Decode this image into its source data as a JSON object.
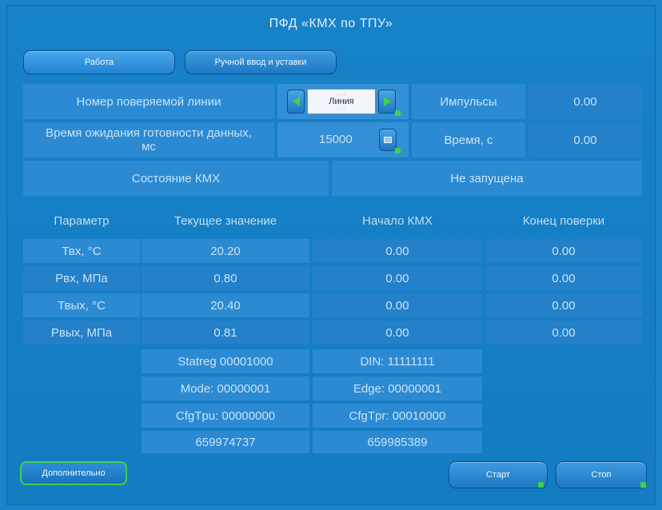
{
  "title": "ПФД «КМХ по ТПУ»",
  "tabs": {
    "work": "Работа",
    "manual": "Ручной ввод и уставки"
  },
  "line_row": {
    "label": "Номер поверяемой линии",
    "line_value": "Линия",
    "impulses_label": "Импульсы",
    "impulses_value": "0.00"
  },
  "wait_row": {
    "label": "Время ожидания готовности данных, мс",
    "value": "15000",
    "time_label": "Время, с",
    "time_value": "0.00"
  },
  "state_row": {
    "label": "Состояние КМХ",
    "value": "Не запущена"
  },
  "table": {
    "headers": [
      "Параметр",
      "Текущее значение",
      "Начало КМХ",
      "Конец поверки"
    ],
    "rows": [
      [
        "Твх, °С",
        "20.20",
        "0.00",
        "0.00"
      ],
      [
        "Рвх, МПа",
        "0.80",
        "0.00",
        "0.00"
      ],
      [
        "Твых, °С",
        "20.40",
        "0.00",
        "0.00"
      ],
      [
        "Рвых, МПа",
        "0.81",
        "0.00",
        "0.00"
      ]
    ]
  },
  "status": {
    "statreg": "Statreg 00001000",
    "din": "DIN:   11111111",
    "mode": "Mode:   00000001",
    "edge": "Edge:   00000001",
    "cfgtpu": "CfgTpu:   00000000",
    "cfgtpr": "CfgTpr:  00010000",
    "counter1": "659974737",
    "counter2": "659985389"
  },
  "buttons": {
    "extra": "Дополнительно",
    "start": "Старт",
    "stop": "Стоп"
  },
  "colors": {
    "background": "#1682c8",
    "accent_green": "#3fd24a"
  },
  "icons": {
    "prev": "arrow-left-icon",
    "next": "arrow-right-icon",
    "keyboard": "keyboard-icon"
  }
}
